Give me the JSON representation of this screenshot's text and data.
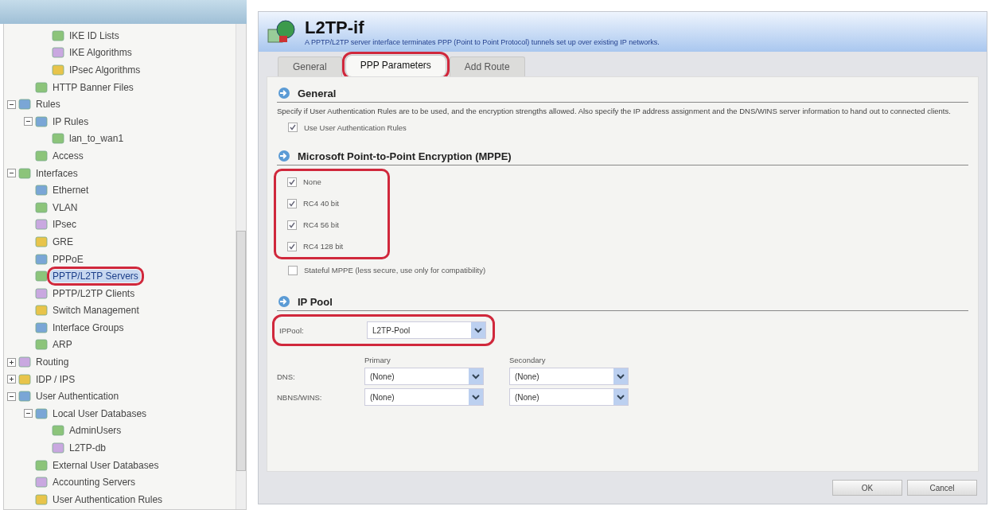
{
  "tree": {
    "items": [
      {
        "children": [
          {
            "children": [
              {
                "label": "IKE ID Lists"
              },
              {
                "label": "IKE Algorithms"
              },
              {
                "label": "IPsec Algorithms"
              }
            ]
          },
          {
            "label": "HTTP Banner Files"
          }
        ]
      },
      {
        "label": "Rules",
        "expanded": true,
        "children": [
          {
            "label": "IP Rules",
            "expanded": true,
            "children": [
              {
                "label": "lan_to_wan1"
              }
            ]
          },
          {
            "label": "Access"
          }
        ]
      },
      {
        "label": "Interfaces",
        "expanded": true,
        "children": [
          {
            "label": "Ethernet"
          },
          {
            "label": "VLAN"
          },
          {
            "label": "IPsec"
          },
          {
            "label": "GRE"
          },
          {
            "label": "PPPoE"
          },
          {
            "label": "PPTP/L2TP Servers",
            "selected": true,
            "highlighted": true
          },
          {
            "label": "PPTP/L2TP Clients"
          },
          {
            "label": "Switch Management"
          },
          {
            "label": "Interface Groups"
          },
          {
            "label": "ARP"
          }
        ]
      },
      {
        "label": "Routing",
        "expanded": false
      },
      {
        "label": "IDP / IPS",
        "expanded": false
      },
      {
        "label": "User Authentication",
        "expanded": true,
        "children": [
          {
            "label": "Local User Databases",
            "expanded": true,
            "children": [
              {
                "label": "AdminUsers"
              },
              {
                "label": "L2TP-db"
              }
            ]
          },
          {
            "label": "External User Databases"
          },
          {
            "label": "Accounting Servers"
          },
          {
            "label": "User Authentication Rules"
          }
        ]
      }
    ]
  },
  "dialog": {
    "title": "L2TP-if",
    "description": "A PPTP/L2TP server interface terminates PPP (Point to Point Protocol) tunnels set up over existing IP networks.",
    "tabs": [
      {
        "label": "General",
        "selected": false,
        "highlighted": false
      },
      {
        "label": "PPP Parameters",
        "selected": true,
        "highlighted": true
      },
      {
        "label": "Add Route",
        "selected": false,
        "highlighted": false
      }
    ],
    "general": {
      "heading": "General",
      "text": "Specify if User Authentication Rules are to be used, and the encryption strengths allowed. Also specify the IP address assignment and the DNS/WINS server information to hand out to connected clients.",
      "options": [
        {
          "label": "Use User Authentication Rules",
          "checked": true
        }
      ]
    },
    "mppe": {
      "heading": "Microsoft Point-to-Point Encryption (MPPE)",
      "options": [
        {
          "label": "None",
          "checked": true,
          "highlighted": true
        },
        {
          "label": "RC4 40 bit",
          "checked": true,
          "highlighted": true
        },
        {
          "label": "RC4 56 bit",
          "checked": true,
          "highlighted": true
        },
        {
          "label": "RC4 128 bit",
          "checked": true,
          "highlighted": true
        },
        {
          "label": "Stateful MPPE (less secure, use only for compatibility)",
          "checked": false,
          "highlighted": false
        }
      ]
    },
    "ip_pool": {
      "heading": "IP Pool",
      "label": "IPPool:",
      "value": "L2TP-Pool",
      "highlighted": true,
      "columns": [
        "Primary",
        "Secondary"
      ],
      "rows": [
        {
          "label": "DNS:",
          "values": [
            "(None)",
            "(None)"
          ]
        },
        {
          "label": "NBNS/WINS:",
          "values": [
            "(None)",
            "(None)"
          ]
        }
      ]
    },
    "buttons": [
      "OK",
      "Cancel"
    ]
  }
}
